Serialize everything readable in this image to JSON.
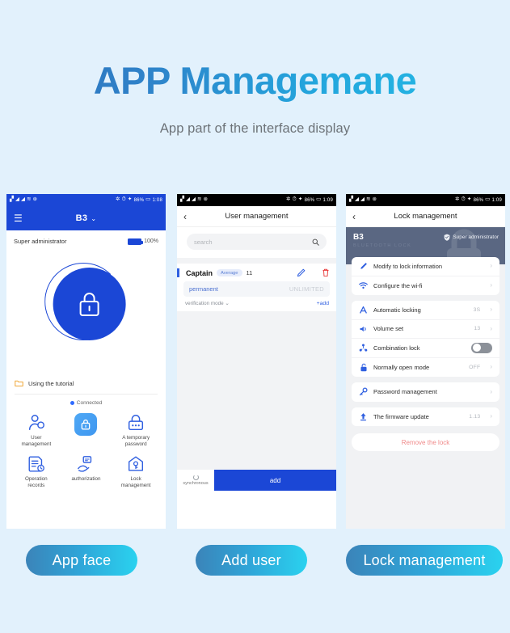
{
  "hero": {
    "title": "APP Managemane",
    "subtitle": "App part of the interface display"
  },
  "colors": {
    "background": "#e2f1fc",
    "brand_blue": "#1b47d6",
    "accent_cyan": "#2ad2ef",
    "title_gradient_start": "#2d6fb8",
    "title_gradient_end": "#24bde6",
    "banner_slate": "#5a6782",
    "danger_red": "#f08a8a"
  },
  "status_bar": {
    "left_icons": [
      "signal-icon",
      "signal-bars-icon",
      "signal-bars-icon",
      "wifi-icon",
      "sim-icon"
    ],
    "right_icons": [
      "settings-icon",
      "alarm-icon",
      "bluetooth-icon",
      "battery-icon"
    ],
    "battery_percent": "86%",
    "time_phone1": "1:08",
    "time_phone2": "1:09",
    "time_phone3": "1:09"
  },
  "phone1": {
    "menu_icon": "hamburger-menu-icon",
    "title": "B3",
    "chevron": "⌄",
    "admin_label": "Super administrator",
    "battery_label": "100%",
    "lock_icon": "lock-closed-icon",
    "tutorial_label": "Using the tutorial",
    "connected_label": "Connected",
    "grid": [
      {
        "label": "User\nmanagement",
        "icon": "user-management-icon",
        "highlight": false
      },
      {
        "label": "",
        "icon": "lock-tile-icon",
        "highlight": true
      },
      {
        "label": "A temporary\npassword",
        "icon": "temporary-password-icon",
        "highlight": false
      },
      {
        "label": "Operation\nrecords",
        "icon": "operation-records-icon",
        "highlight": false
      },
      {
        "label": "authorization",
        "icon": "authorization-icon",
        "highlight": false
      },
      {
        "label": "Lock\nmanagement",
        "icon": "lock-management-icon",
        "highlight": false
      }
    ]
  },
  "phone2": {
    "back_icon": "chevron-left-icon",
    "title": "User management",
    "search_placeholder": "search",
    "search_icon": "search-icon",
    "user": {
      "name": "Captain",
      "badge": "Average",
      "count": "11",
      "edit_icon": "pencil-edit-icon",
      "delete_icon": "trash-delete-icon",
      "permission_key": "permanent",
      "permission_value": "UNLIMITED",
      "verification_label": "verification mode",
      "verification_chevron": "⌄",
      "add_label": "add",
      "add_plus": "+"
    },
    "sync_label": "synchronous",
    "sync_icon": "sync-spinner-icon",
    "add_button": "add"
  },
  "phone3": {
    "back_icon": "chevron-left-icon",
    "title": "Lock management",
    "banner": {
      "name": "B3",
      "subtitle": "BLUETOOTH LOCK",
      "admin_label": "Super administrator",
      "admin_icon": "shield-icon",
      "watermark_icon": "lock-watermark-icon"
    },
    "groups": [
      {
        "rows": [
          {
            "label": "Modify to lock information",
            "value": "",
            "icon": "pencil-edit-icon",
            "type": "chevron"
          },
          {
            "label": "Configure the wi-fi",
            "value": "",
            "icon": "wifi-icon",
            "type": "chevron"
          }
        ]
      },
      {
        "rows": [
          {
            "label": "Automatic locking",
            "value": "3S",
            "icon": "auto-lock-icon",
            "type": "chevron"
          },
          {
            "label": "Volume set",
            "value": "13",
            "icon": "volume-icon",
            "type": "chevron"
          },
          {
            "label": "Combination lock",
            "value": "",
            "icon": "combination-lock-icon",
            "type": "toggle",
            "toggle_on": false
          },
          {
            "label": "Normally open mode",
            "value": "OFF",
            "icon": "open-lock-icon",
            "type": "chevron"
          }
        ]
      },
      {
        "rows": [
          {
            "label": "Password management",
            "value": "",
            "icon": "key-icon",
            "type": "chevron"
          }
        ]
      },
      {
        "rows": [
          {
            "label": "The firmware update",
            "value": "1.13",
            "icon": "upload-icon",
            "type": "chevron"
          }
        ]
      }
    ],
    "remove_button": "Remove the lock"
  },
  "captions": [
    {
      "label": "App face"
    },
    {
      "label": "Add user"
    },
    {
      "label": "Lock management"
    }
  ]
}
